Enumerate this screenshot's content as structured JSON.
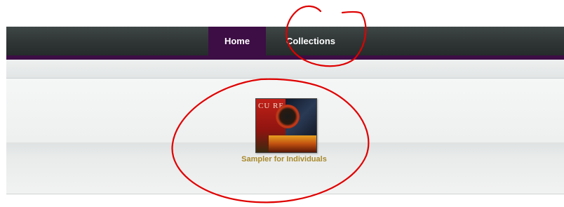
{
  "nav": {
    "tabs": [
      {
        "label": "Home",
        "active": true
      },
      {
        "label": "Collections",
        "active": false
      }
    ],
    "colors": {
      "bar": "#2f3535",
      "active_tab": "#3d0d45",
      "underline": "#3d0d45",
      "text": "#ffffff"
    }
  },
  "collections": [
    {
      "label": "Sampler for Individuals",
      "label_color": "#a8892a",
      "thumbnail_text": "CU RE"
    }
  ],
  "annotations": {
    "color": "#e00000",
    "circles": [
      "around-collections-tab",
      "around-sampler-collection"
    ]
  }
}
